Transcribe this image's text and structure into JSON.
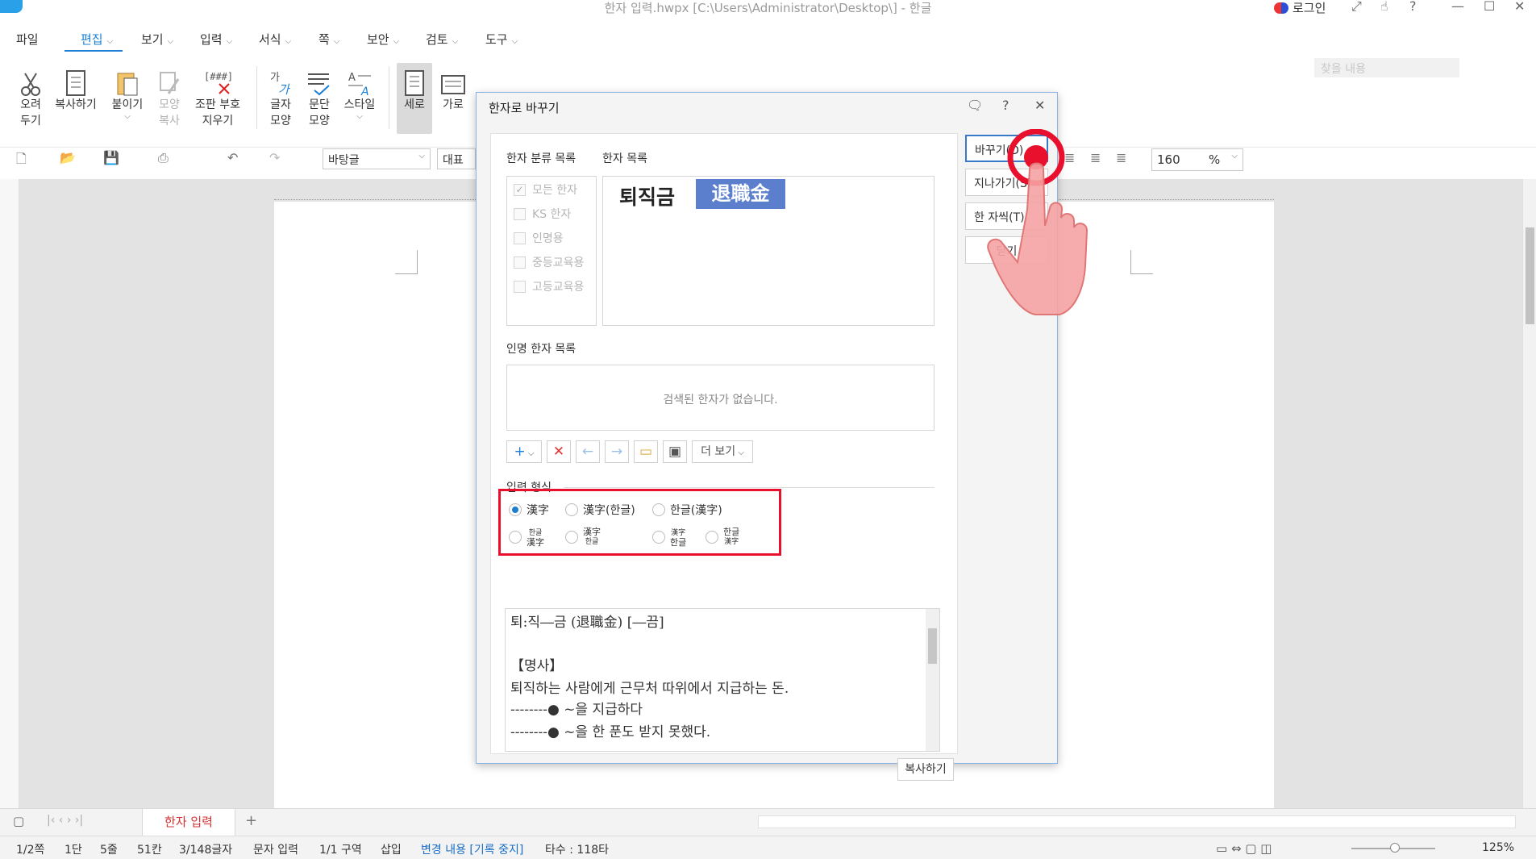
{
  "window": {
    "title": "한자 입력.hwpx [C:\\Users\\Administrator\\Desktop\\] - 한글",
    "login_label": "로그인"
  },
  "menu": {
    "items": [
      "파일",
      "편집",
      "보기",
      "입력",
      "서식",
      "쪽",
      "보안",
      "검토",
      "도구"
    ],
    "active": "편집",
    "find_placeholder": "찾을 내용"
  },
  "ribbon": {
    "buttons": [
      {
        "label": "오려\n두기",
        "icon": "scissors-icon"
      },
      {
        "label": "복사하기",
        "icon": "copy-icon"
      },
      {
        "label": "붙이기",
        "icon": "paste-icon"
      },
      {
        "label": "모양\n복사",
        "icon": "format-painter-icon"
      },
      {
        "label": "조판 부호\n지우기",
        "icon": "clear-codes-icon"
      },
      {
        "label": "글자\n모양",
        "icon": "char-shape-icon"
      },
      {
        "label": "문단\n모양",
        "icon": "para-shape-icon"
      },
      {
        "label": "스타일",
        "icon": "style-icon"
      },
      {
        "label": "세로",
        "icon": "vertical-icon"
      },
      {
        "label": "가로",
        "icon": "horizontal-icon"
      }
    ]
  },
  "toolbar": {
    "style_combo": "바탕글",
    "font_combo": "대표",
    "zoom_value": "160",
    "zoom_unit": "%"
  },
  "sheet_tab": "한자 입력",
  "status": {
    "page": "1/2쪽",
    "column": "1단",
    "line": "5줄",
    "col": "51칸",
    "chars": "3/148글자",
    "mode": "문자 입력",
    "section": "1/1 구역",
    "insert": "삽입",
    "track": "변경 내용 [기록 중지]",
    "typing": "타수 : 118타",
    "zoom": "125%"
  },
  "dialog": {
    "title": "한자로 바꾸기",
    "category_label": "한자 분류 목록",
    "hanja_list_label": "한자 목록",
    "categories": [
      {
        "label": "모든 한자",
        "checked": true
      },
      {
        "label": "KS 한자",
        "checked": false
      },
      {
        "label": "인명용",
        "checked": false
      },
      {
        "label": "중등교육용",
        "checked": false
      },
      {
        "label": "고등교육용",
        "checked": false
      }
    ],
    "hangul_word": "퇴직금",
    "hanja_word": "退職金",
    "name_hanja_label": "인명 한자 목록",
    "name_hanja_empty": "검색된 한자가 없습니다.",
    "more_label": "더 보기",
    "input_format_label": "입력 형식",
    "formats_row1": [
      "漢字",
      "漢字(한글)",
      "한글(漢字)"
    ],
    "formats_row2": [
      {
        "top": "한글",
        "bottom": "漢字"
      },
      {
        "top": "漢字",
        "bottom": "한글"
      },
      {
        "top": "漢字",
        "bottom": "한글"
      },
      {
        "top": "한글",
        "bottom": "漢字"
      }
    ],
    "selected_format": "漢字",
    "meaning_lines": [
      "퇴:직―금 (退職金) [―끔]",
      "",
      "【명사】",
      "퇴직하는 사람에게 근무처 따위에서 지급하는 돈.",
      "--------● ~을 지급하다",
      "--------● ~을 한 푼도 받지 못했다."
    ],
    "copy_label": "복사하기",
    "buttons": {
      "replace": "바꾸기(D)",
      "skip": "지나가기(S)",
      "one_char": "한 자씩(T)",
      "close": "닫기"
    }
  },
  "colors": {
    "accent": "#1a7fd4",
    "hanja_chip": "#5b7fcd",
    "highlight_rect": "#e8102c",
    "touch_red": "#e8102c"
  }
}
